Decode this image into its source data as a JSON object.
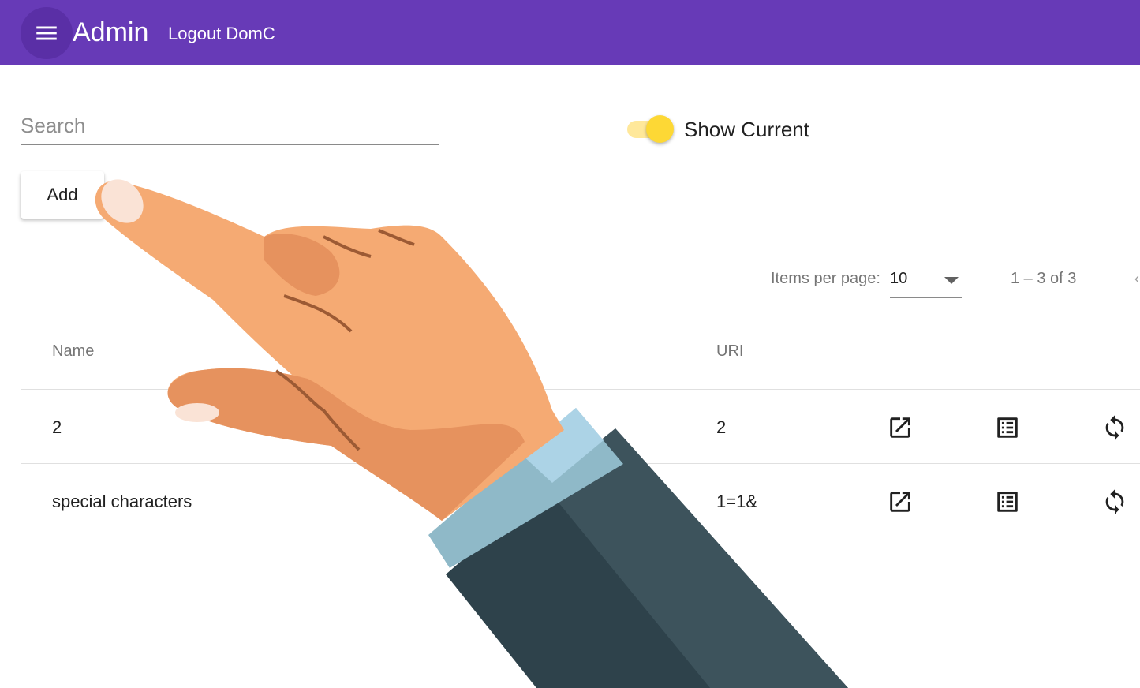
{
  "toolbar": {
    "title": "Admin",
    "logout_label": "Logout DomC",
    "menu_icon": "menu-icon",
    "color": "#673ab7"
  },
  "search": {
    "placeholder": "Search",
    "value": ""
  },
  "toggle": {
    "label": "Show Current",
    "checked": true,
    "color": "#fdd835"
  },
  "actions": {
    "add_label": "Add"
  },
  "paginator": {
    "items_per_page_label": "Items per page:",
    "page_size": "10",
    "range_label": "1 – 3 of 3"
  },
  "table": {
    "columns": [
      "Name",
      "URI"
    ],
    "rows": [
      {
        "name": "2",
        "uri": "2"
      },
      {
        "name": "special characters",
        "uri": "1=1&"
      }
    ],
    "row_actions": [
      "open-in-new-icon",
      "list-icon",
      "refresh-icon"
    ]
  }
}
